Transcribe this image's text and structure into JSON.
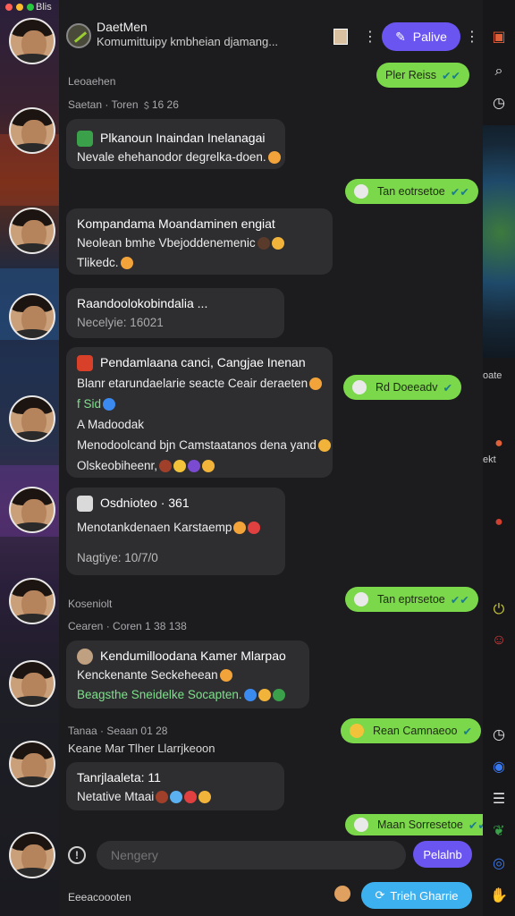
{
  "titlebar": {
    "app_name": "Blis"
  },
  "header": {
    "title": "DaetMen",
    "subtitle": "Komumittuipy kmbheian djamang...",
    "live_label": "Palive"
  },
  "conversation": {
    "date_label": "Leoaehen",
    "items": [
      {
        "type": "time",
        "text": "Saetan · Toren ﹩16 26"
      },
      {
        "type": "in",
        "title": "Plkanoun Inaindan Inelanagai",
        "lines": [
          "Nevale ehehanodor degrelka-doen."
        ]
      },
      {
        "type": "out",
        "text": "Tan eotrsetoe"
      },
      {
        "type": "in",
        "title": "Kompandama Moandaminen engiat",
        "lines": [
          "Neolean bmhe Vbejoddenemenic",
          "Tlikedc."
        ]
      },
      {
        "type": "in",
        "title": "Raandoolokobindalia ...",
        "lines": [
          "Necelyie: 16021"
        ]
      },
      {
        "type": "in",
        "title": "Pendamlaana canci, Cangjae Inenan",
        "lines": [
          "Blanr etarundaelarie seacte Ceair deraeten",
          "f Sid",
          "A Madoodak",
          "Menodoolcand bjn Camstaatanos dena yand",
          "Olskeobiheenr,"
        ]
      },
      {
        "type": "out",
        "text": "Rd Doeeadv"
      },
      {
        "type": "in",
        "title": "Osdnioteo · 361",
        "lines": [
          "Menotankdenaen Karstaemp",
          "Nagtiye: 10/7/0"
        ]
      },
      {
        "type": "date",
        "text": "Koseniolt"
      },
      {
        "type": "out",
        "text": "Tan eptrsetoe"
      },
      {
        "type": "time",
        "text": "Cearen · Coren 1 38 138"
      },
      {
        "type": "in",
        "title": "Kendumilloodana Kamer Mlarpao",
        "lines": [
          "Kenckenante Seckeheean",
          "Beagsthe Sneidelke Socapten."
        ]
      },
      {
        "type": "time",
        "text": "Tanaa · Seaan 01 28"
      },
      {
        "type": "out",
        "text": "Rean Camnaeoo"
      },
      {
        "type": "time",
        "text": "Keane Mar Tlher Llarrjkeoon"
      },
      {
        "type": "in",
        "title": "Tanrjlaaleta: 11",
        "lines": [
          "Netative  Mtaai"
        ]
      },
      {
        "type": "out",
        "text": "Maan Sorresetoe"
      }
    ]
  },
  "composer": {
    "placeholder": "Nengery",
    "send_label": "Pelalnb",
    "footer_label": "Eeeacoooten",
    "cta_label": "Trieh Gharrie"
  },
  "right_rail": {
    "text_1": "oate",
    "text_2": "ekt"
  },
  "colors": {
    "accent": "#6a55f0",
    "outgoing": "#7bd84b",
    "cta": "#3db1f0",
    "bubble": "#2e2e31"
  }
}
